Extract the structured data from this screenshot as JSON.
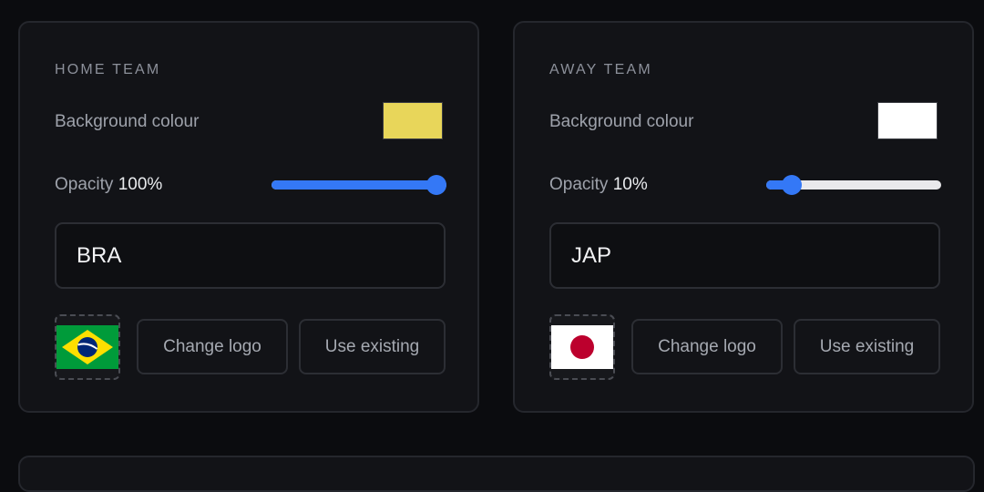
{
  "home": {
    "title": "HOME TEAM",
    "background_label": "Background colour",
    "background_color": "#e8d65a",
    "opacity_label": "Opacity",
    "opacity_value": "100%",
    "opacity_fraction": 1.0,
    "team_code": "BRA",
    "flag_icon": "brazil-flag-icon",
    "change_logo_label": "Change logo",
    "use_existing_label": "Use existing"
  },
  "away": {
    "title": "AWAY TEAM",
    "background_label": "Background colour",
    "background_color": "#ffffff",
    "opacity_label": "Opacity",
    "opacity_value": "10%",
    "opacity_fraction": 0.1,
    "team_code": "JAP",
    "flag_icon": "japan-flag-icon",
    "change_logo_label": "Change logo",
    "use_existing_label": "Use existing"
  },
  "colors": {
    "accent": "#3478f6",
    "panel_bg": "#121317",
    "page_bg": "#0b0c0f"
  }
}
